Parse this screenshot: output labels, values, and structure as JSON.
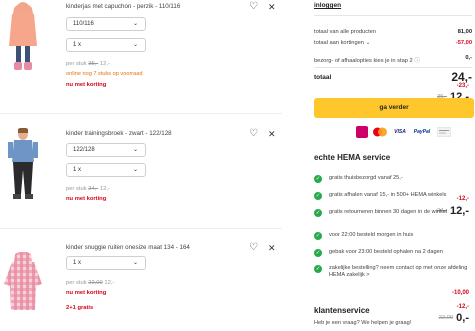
{
  "items": [
    {
      "name": "kinderjas met capuchon - perzik - 110/116",
      "size": "110/116",
      "qty": "1 x",
      "unit_prefix": "per stuk",
      "unit_old": "35,-",
      "unit_new": "12,-",
      "stock": "online nog 7 stuks op voorraad",
      "promo": "nu met korting",
      "discount": "-23,-",
      "old_price": "35,-",
      "price": "12,-"
    },
    {
      "name": "kinder trainingsbroek - zwart - 122/128",
      "size": "122/128",
      "qty": "1 x",
      "unit_prefix": "per stuk",
      "unit_old": "24,-",
      "unit_new": "12,-",
      "promo": "nu met korting",
      "discount": "-12,-",
      "old_price": "24,-",
      "price": "12,-"
    },
    {
      "name": "kinder snuggie ruiten onesize maat 134 - 164",
      "qty": "1 x",
      "unit_prefix": "per stuk",
      "unit_old": "22,00",
      "unit_new": "12,-",
      "promo": "nu met korting",
      "promo2": "2+1 gratis",
      "discount": "-10,00",
      "discount2": "-12,-",
      "old_price": "22,00",
      "price": "0,-"
    }
  ],
  "summary": {
    "login": "inloggen",
    "total_products_label": "totaal van alle producten",
    "total_products_value": "81,00",
    "total_discounts_label": "totaal aan kortingen",
    "total_discounts_value": "-57,00",
    "shipping_label": "bezorg- of afhaalopties kies je in stap 2",
    "shipping_value": "0,-",
    "total_label": "totaal",
    "total_value": "24,-",
    "checkout_button": "ga verder",
    "payment_methods": [
      "iDEAL",
      "Mastercard",
      "VISA",
      "PayPal",
      "bank"
    ]
  },
  "service": {
    "title": "echte HEMA service",
    "items": [
      "gratis thuisbezorgd vanaf 25,-",
      "gratis afhalen vanaf 15,- in 500+ HEMA winkels",
      "gratis retourneren binnen 30 dagen in de winkel",
      "voor 22:00 besteld morgen in huis",
      "gebak voor 23:00 besteld ophalen na 2 dagen",
      "zakelijke bestelling? neem contact op met onze afdeling HEMA zakelijk >"
    ]
  },
  "customer_service": {
    "title": "klantenservice",
    "subtitle": "Heb je een vraag? We helpen je graag!"
  },
  "colors": {
    "accent": "#ffc72c",
    "sale": "#d6061d",
    "stock": "#e8710a",
    "check": "#2aa94a"
  }
}
